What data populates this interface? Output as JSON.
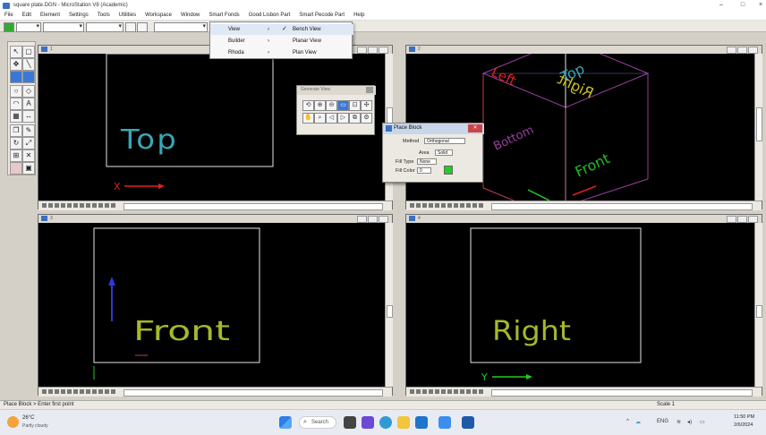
{
  "window": {
    "title": "square plate.DGN - MicroStation V8 (Academic)"
  },
  "menu": [
    "File",
    "Edit",
    "Element",
    "Settings",
    "Tools",
    "Utilities",
    "Workspace",
    "Window",
    "Smart Fonds",
    "Good Lisbon Part",
    "Smart Pecode Part",
    "Help"
  ],
  "dropdown": {
    "items": [
      {
        "label": "View",
        "arrow": "›",
        "check": "✓",
        "sub": "Bench View"
      },
      {
        "label": "Builder",
        "arrow": "›",
        "check": "",
        "sub": "Planar View"
      },
      {
        "label": "Rhoda",
        "arrow": "›",
        "check": "",
        "sub": "Plan View"
      }
    ]
  },
  "views": {
    "top": {
      "label": "Top",
      "axis": "X"
    },
    "iso": {
      "labels": [
        "Top",
        "Left",
        "Right",
        "Bottom",
        "Front"
      ]
    },
    "front": {
      "label": "Front"
    },
    "right": {
      "label": "Right",
      "axis": "Y"
    }
  },
  "view_control": {
    "title": "Generate View"
  },
  "place_block": {
    "title": "Place Block",
    "method_label": "Method",
    "method_value": "Orthogonal",
    "area_label": "Area",
    "area_value": "Solid",
    "fill_type_label": "Fill Type",
    "fill_type_value": "None",
    "fill_color_label": "Fill Color",
    "fill_color_value": "0",
    "fill_color_swatch": "#22cc22"
  },
  "status": {
    "text": "Place Block > Enter first point"
  },
  "taskbar": {
    "weather_temp": "26°C",
    "weather_desc": "Partly cloudy",
    "search_label": "Search",
    "tray_lang": "ENG",
    "clock_time": "11:50 PM",
    "clock_date": "2/6/2024",
    "scale_label": "Scale 1"
  },
  "colors": {
    "cyan": "#3aa7b8",
    "yellow_green": "#a6b82a",
    "red": "#e02020",
    "green": "#22cc22",
    "magenta": "#a030a0",
    "blue": "#2d3bd8",
    "white": "#e6e6e6"
  }
}
